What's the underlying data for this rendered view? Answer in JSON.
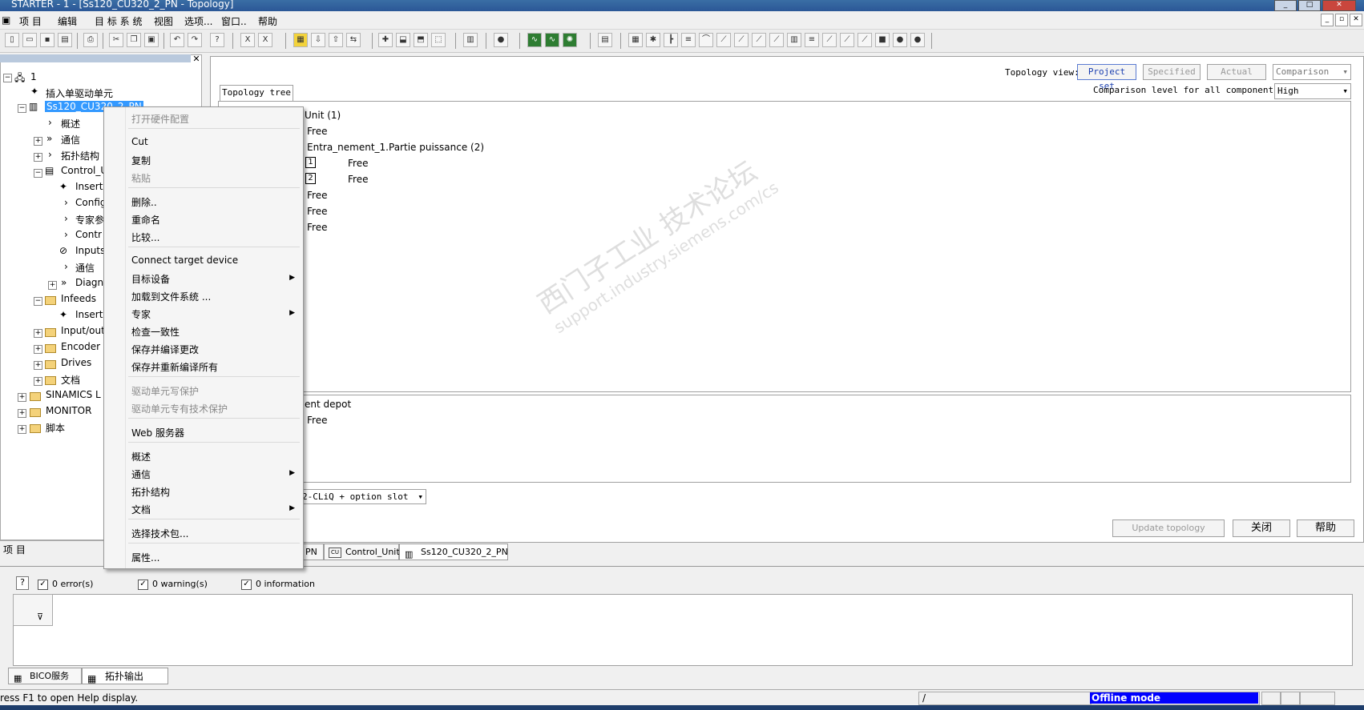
{
  "window": {
    "title": "STARTER - 1 - [Ss120_CU320_2_PN - Topology]"
  },
  "menubar": {
    "items": [
      "项 目",
      "编辑",
      "目 标 系 统",
      "视图",
      "选项...",
      "窗口..",
      "帮助"
    ]
  },
  "tree": {
    "root_label": "1",
    "items": [
      "插入单驱动单元",
      "Ss120_CU320_2_PN",
      "概述",
      "通信",
      "拓扑结构",
      "Control_U",
      "Insert",
      "Config",
      "专家参",
      "Contr",
      "Inputs",
      "通信",
      "Diagn",
      "Infeeds",
      "Insert",
      "Input/out",
      "Encoder",
      "Drives",
      "文档",
      "SINAMICS L",
      "MONITOR",
      "脚本"
    ],
    "bottom_tab": "项 目"
  },
  "topology": {
    "view_label": "Topology view:",
    "view_buttons": [
      "Project set",
      "Specified",
      "Actual"
    ],
    "comparison_select": "Comparison",
    "comparison_level_label": "Comparison level for all components:",
    "comparison_level_value": "High",
    "tree_tab": "Topology tree",
    "rows": [
      "Unit (1)",
      "Free",
      "Entra_nement_1.Partie puissance (2)",
      "Free",
      "Free",
      "Free",
      "Free",
      "Free"
    ],
    "port_labels": [
      "1",
      "2"
    ],
    "depot_title": "ent depot",
    "depot_row": "Free",
    "slot_select": "2-CLiQ + option slot",
    "update_button": "Update topology",
    "close_button": "关闭",
    "help_button": "帮助"
  },
  "workspace_tabs": [
    "PN",
    "Control_Unit",
    "Ss120_CU320_2_PN"
  ],
  "context_menu": {
    "items": [
      {
        "label": "打开硬件配置",
        "disabled": true
      },
      {
        "label": "Cut",
        "disabled": false
      },
      {
        "label": "复制",
        "disabled": false
      },
      {
        "label": "粘贴",
        "disabled": true
      },
      {
        "label": "删除..",
        "disabled": false
      },
      {
        "label": "重命名",
        "disabled": false
      },
      {
        "label": "比较...",
        "disabled": false
      },
      {
        "label": "Connect target device",
        "disabled": false
      },
      {
        "label": "目标设备",
        "disabled": false
      },
      {
        "label": "加载到文件系统 ...",
        "disabled": false
      },
      {
        "label": "专家",
        "disabled": false
      },
      {
        "label": "检查一致性",
        "disabled": false
      },
      {
        "label": "保存并编译更改",
        "disabled": false
      },
      {
        "label": "保存并重新编译所有",
        "disabled": false
      },
      {
        "label": "驱动单元写保护",
        "disabled": true
      },
      {
        "label": "驱动单元专有技术保护",
        "disabled": true
      },
      {
        "label": "Web 服务器",
        "disabled": false
      },
      {
        "label": "概述",
        "disabled": false
      },
      {
        "label": "通信",
        "disabled": false
      },
      {
        "label": "拓扑结构",
        "disabled": false
      },
      {
        "label": "文档",
        "disabled": false
      },
      {
        "label": "选择技术包...",
        "disabled": false
      },
      {
        "label": "属性...",
        "disabled": false
      }
    ]
  },
  "output": {
    "errors": "0 error(s)",
    "warnings": "0 warning(s)",
    "information": "0 information",
    "tabs": [
      "BICO服务",
      "拓扑输出"
    ]
  },
  "status": {
    "help_text": "ress F1 to open Help display.",
    "slash": "/",
    "mode": "Offline mode"
  },
  "watermark": {
    "line1": "西门子工业 技术论坛",
    "line2": "support.industry.siemens.com/cs"
  },
  "colors": {
    "selection": "#3399ff",
    "offline_mode": "#0000ff",
    "titlebar": "#2b5797"
  }
}
